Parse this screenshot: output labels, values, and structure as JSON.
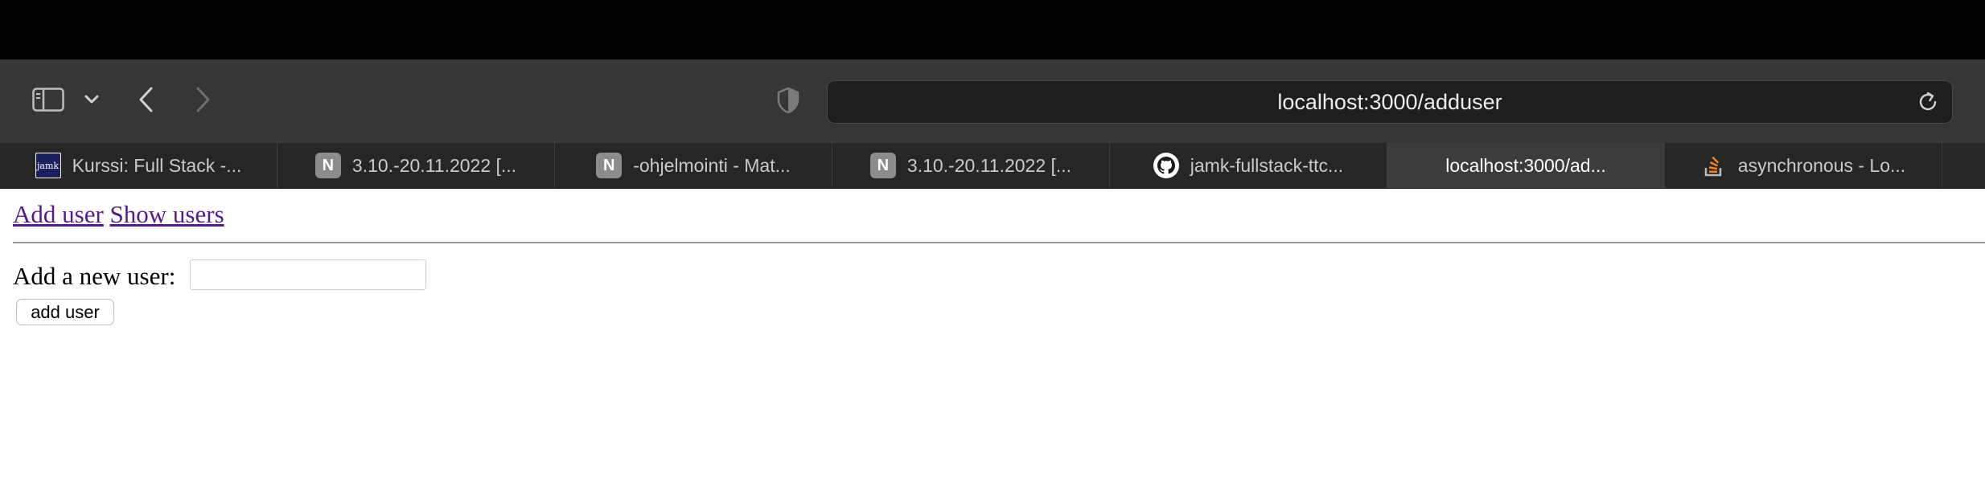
{
  "browser": {
    "url": "localhost:3000/adduser",
    "tabs": [
      {
        "title": "Kurssi: Full Stack -...",
        "favicon": "jamk-icon",
        "favicon_text": "jamk"
      },
      {
        "title": "3.10.-20.11.2022 [...",
        "favicon": "notion-icon",
        "favicon_text": "N"
      },
      {
        "title": "-ohjelmointi - Mat...",
        "favicon": "notion-icon",
        "favicon_text": "N"
      },
      {
        "title": "3.10.-20.11.2022 [...",
        "favicon": "notion-icon",
        "favicon_text": "N"
      },
      {
        "title": "jamk-fullstack-ttc...",
        "favicon": "github-icon"
      },
      {
        "title": "localhost:3000/ad...",
        "favicon": "none",
        "active": true
      },
      {
        "title": "asynchronous - Lo...",
        "favicon": "stackoverflow-icon"
      }
    ]
  },
  "page": {
    "nav": {
      "add_user": "Add user",
      "show_users": "Show users"
    },
    "form": {
      "label": "Add a new user:",
      "input_value": "",
      "button_label": "add user"
    }
  },
  "colors": {
    "link_visited": "#551a8b",
    "toolbar": "#363636",
    "tabstrip": "#262626",
    "active_tab": "#3c3c3c"
  }
}
